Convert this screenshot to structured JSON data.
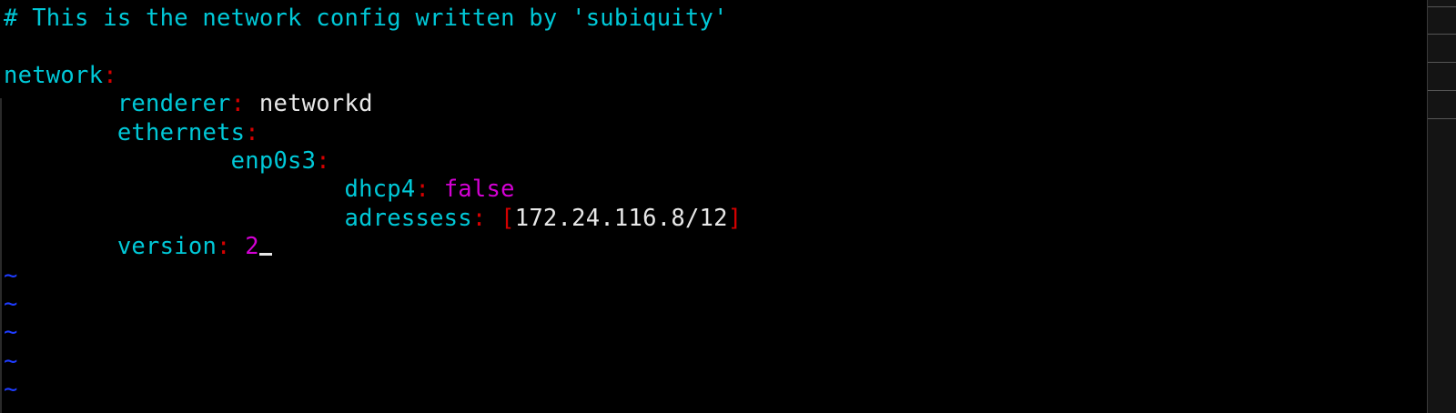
{
  "colors": {
    "background": "#000000",
    "comment": "#00c8d7",
    "key": "#00c8d7",
    "punct": "#d40000",
    "plain": "#e8e8e8",
    "bool": "#d400d4",
    "number": "#d400d4",
    "tilde": "#1e3cff",
    "cursor": "#e8e8e8"
  },
  "editor": {
    "comment_line": "# This is the network config written by 'subiquity'",
    "network_key": "network",
    "colon": ":",
    "renderer_key": "renderer",
    "renderer_value": "networkd",
    "ethernets_key": "ethernets",
    "iface_key": "enp0s3",
    "dhcp4_key": "dhcp4",
    "dhcp4_value": "false",
    "addresses_key": "adressess",
    "bracket_open": "[",
    "address_value": "172.24.116.8/12",
    "bracket_close": "]",
    "version_key": "version",
    "version_value": "2",
    "tilde": "~"
  }
}
